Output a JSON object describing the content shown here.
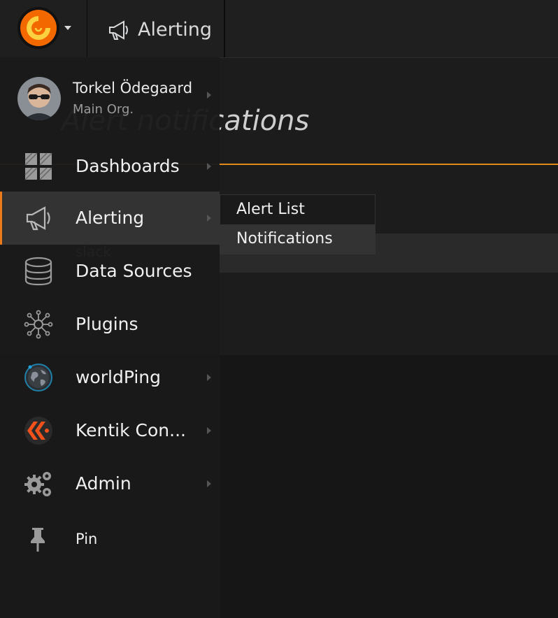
{
  "navbar": {
    "section_title": "Alerting"
  },
  "page": {
    "title": "Alert notifications",
    "list_item": "slack"
  },
  "user": {
    "name": "Torkel Ödegaard",
    "org": "Main Org."
  },
  "sidemenu": {
    "items": [
      {
        "label": "Dashboards",
        "icon": "dashboards-icon"
      },
      {
        "label": "Alerting",
        "icon": "megaphone-icon"
      },
      {
        "label": "Data Sources",
        "icon": "database-icon"
      },
      {
        "label": "Plugins",
        "icon": "plugins-icon"
      },
      {
        "label": "worldPing",
        "icon": "globe-icon"
      },
      {
        "label": "Kentik Con...",
        "icon": "kentik-icon"
      },
      {
        "label": "Admin",
        "icon": "gears-icon"
      },
      {
        "label": "Pin",
        "icon": "pin-icon"
      }
    ]
  },
  "submenu": {
    "items": [
      {
        "label": "Alert List"
      },
      {
        "label": "Notifications"
      }
    ]
  },
  "colors": {
    "accent": "#eb7b18",
    "rule": "#e2891c",
    "background": "#161616"
  }
}
